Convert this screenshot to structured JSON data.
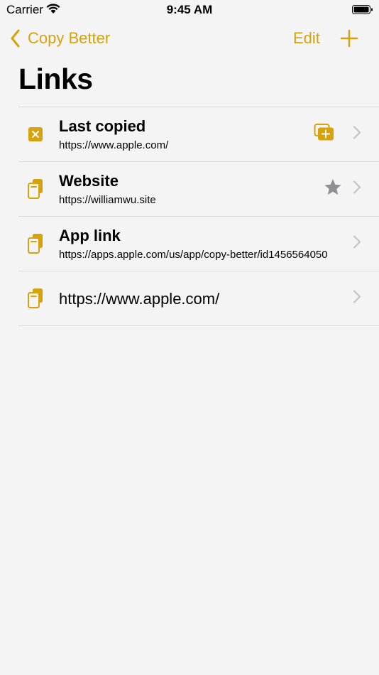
{
  "status_bar": {
    "carrier": "Carrier",
    "time": "9:45 AM"
  },
  "nav": {
    "back_label": "Copy Better",
    "edit_label": "Edit"
  },
  "page": {
    "title": "Links"
  },
  "links": [
    {
      "title": "Last copied",
      "url": "https://www.apple.com/",
      "icon": "clear-clipboard-icon",
      "accessory": "paste-add-icon"
    },
    {
      "title": "Website",
      "url": "https://williamwu.site",
      "icon": "clipboard-icon",
      "accessory": "star-icon"
    },
    {
      "title": "App link",
      "url": "https://apps.apple.com/us/app/copy-better/id1456564050",
      "icon": "clipboard-icon",
      "accessory": ""
    },
    {
      "title": "",
      "url": "https://www.apple.com/",
      "icon": "clipboard-icon",
      "accessory": ""
    }
  ],
  "colors": {
    "accent": "#D6A20E",
    "background": "#F4F4F4",
    "separator": "#D9D9D9",
    "chevron": "#C4C4C6",
    "star": "#8E8E93"
  }
}
